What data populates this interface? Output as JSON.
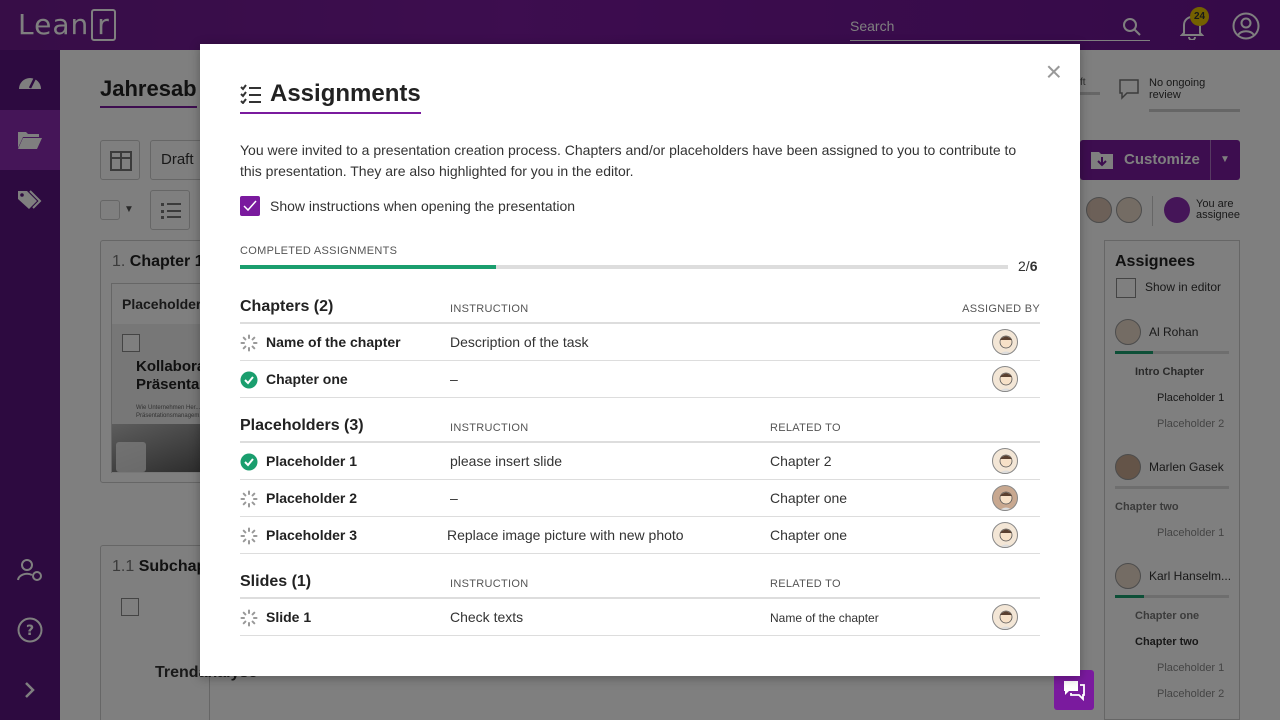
{
  "app": {
    "logo_text": "Lean",
    "logo_box": "r"
  },
  "topbar": {
    "search_placeholder": "Search",
    "notification_count": "24"
  },
  "background": {
    "page_title": "Jahresab",
    "draft_label": "Draft",
    "chapter_1": "1.",
    "chapter_1_title": "Chapter 1",
    "placeholder_label": "Placeholder",
    "slide_title_1": "Kollabora",
    "slide_title_2": "Präsenta",
    "slide_sub": "Wie Unternehmen Her...",
    "slide_sub2": "Präsentationsmanagem...",
    "subchapter_num": "1.1",
    "subchapter_title": "Subchap",
    "trend_label": "Trendanalyse",
    "trend_sub1": "Text hier einfügen Text f",
    "trend_sub2": "Text hier einfügen Text f",
    "customize_label": "Customize",
    "review_status": "No ongoing review",
    "draft_tag": "ft",
    "you_are_assignee": "You are\nassignee",
    "assignees_title": "Assignees",
    "show_in_editor": "Show in editor",
    "people": [
      {
        "name": "Al Rohan",
        "progress": 0.33
      },
      {
        "name": "Marlen Gasek",
        "progress": 0.0
      },
      {
        "name": "Karl Hanselm...",
        "progress": 0.25
      }
    ],
    "al_items": [
      "Intro Chapter",
      "Placeholder 1",
      "Placeholder 2"
    ],
    "marlen_items": [
      "Chapter two",
      "Placeholder 1"
    ],
    "karl_items": [
      "Chapter one",
      "Chapter two",
      "Placeholder 1",
      "Placeholder 2"
    ]
  },
  "modal": {
    "title": "Assignments",
    "intro": "You were invited to a presentation creation process. Chapters and/or placeholders have been assigned to you to contribute to this presentation. They are also highlighted for you in the editor.",
    "show_instructions_label": "Show instructions when opening the presentation",
    "show_instructions_checked": true,
    "completed_label": "COMPLETED ASSIGNMENTS",
    "completed_done": "2",
    "completed_sep": "/",
    "completed_total": "6",
    "completed_fraction": 0.333,
    "chapters": {
      "heading": "Chapters (2)",
      "col_instruction": "INSTRUCTION",
      "col_assigned_by": "ASSIGNED BY",
      "rows": [
        {
          "status": "pending",
          "name": "Name of the chapter",
          "instruction": "Description of the task"
        },
        {
          "status": "done",
          "name": "Chapter one",
          "instruction": "–"
        }
      ]
    },
    "placeholders": {
      "heading": "Placeholders (3)",
      "col_instruction": "INSTRUCTION",
      "col_related": "RELATED TO",
      "rows": [
        {
          "status": "done",
          "name": "Placeholder 1",
          "instruction": "please insert slide",
          "related": "Chapter 2"
        },
        {
          "status": "pending",
          "name": "Placeholder 2",
          "instruction": "–",
          "related": "Chapter one"
        },
        {
          "status": "pending",
          "name": "Placeholder 3",
          "instruction": "Replace image picture with new photo",
          "related": "Chapter one"
        }
      ]
    },
    "slides": {
      "heading": "Slides (1)",
      "col_instruction": "INSTRUCTION",
      "col_related": "RELATED TO",
      "rows": [
        {
          "status": "pending",
          "name": "Slide 1",
          "instruction": "Check texts",
          "related": "Name of the chapter"
        }
      ]
    }
  },
  "colors": {
    "brand": "#7a1a9e",
    "success": "#1a9e6e"
  }
}
